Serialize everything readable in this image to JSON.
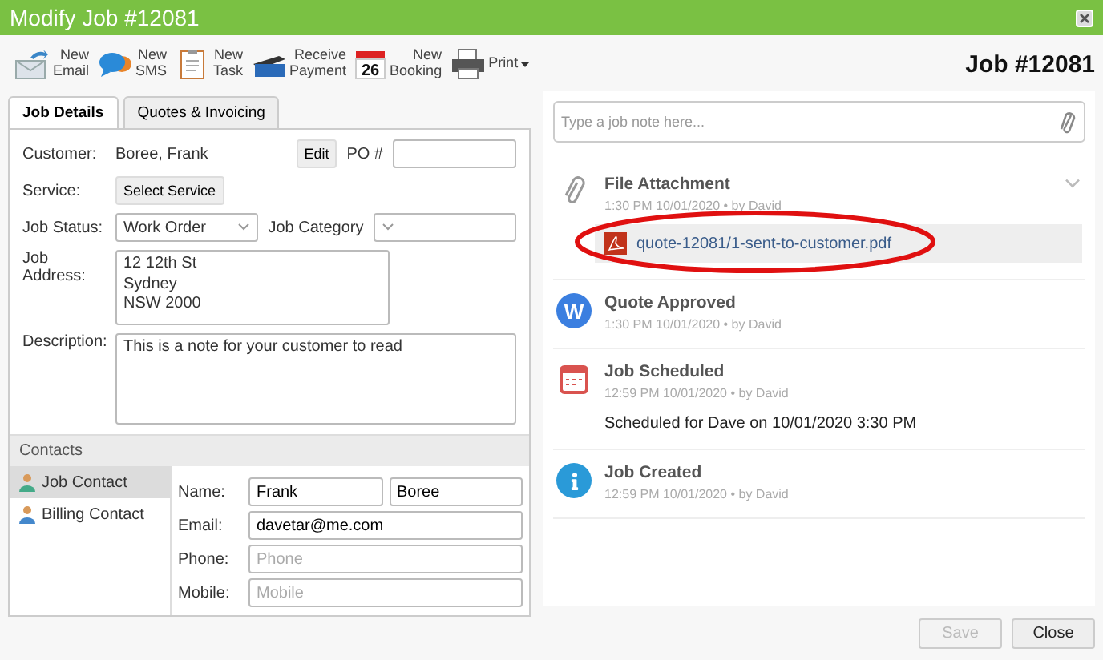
{
  "window": {
    "title": "Modify Job #12081"
  },
  "toolbar": [
    {
      "kind": "email",
      "label": "New Email"
    },
    {
      "kind": "sms",
      "label": "New SMS"
    },
    {
      "kind": "task",
      "label": "New Task"
    },
    {
      "kind": "payment",
      "label": "Receive Payment"
    },
    {
      "kind": "booking",
      "label": "New Booking",
      "badge": "26"
    },
    {
      "kind": "print",
      "label": "Print"
    }
  ],
  "tabs": [
    {
      "label": "Job Details",
      "selected": true
    },
    {
      "label": "Quotes & Invoicing",
      "selected": false
    }
  ],
  "form": {
    "customer_label": "Customer:",
    "customer": "Boree, Frank",
    "edit": "Edit",
    "po_label": "PO #",
    "service_label": "Service:",
    "service_button": "Select Service",
    "status_label": "Job Status:",
    "status": "Work Order",
    "category_label": "Job Category",
    "address_label": "Job Address:",
    "address": "12 12th St\nSydney\nNSW 2000",
    "description_label": "Description:",
    "description": "This is a note for your customer to read"
  },
  "contacts": {
    "title": "Contacts",
    "items": [
      {
        "label": "Job Contact",
        "selected": true
      },
      {
        "label": "Billing Contact",
        "selected": false
      }
    ],
    "fields": [
      {
        "label": "Name:",
        "values": [
          "Frank",
          "Boree"
        ]
      },
      {
        "label": "Email:",
        "value": "davetar@me.com"
      },
      {
        "label": "Phone:",
        "placeholder": "Phone"
      },
      {
        "label": "Mobile:",
        "placeholder": "Mobile"
      }
    ]
  },
  "job_heading": "Job #12081",
  "note": {
    "placeholder": "Type a job note here..."
  },
  "events": [
    {
      "kind": "attachment",
      "title": "File Attachment",
      "meta": "1:30 PM 10/01/2020 • by David",
      "file": "quote-12081/1-sent-to-customer.pdf",
      "expanded": false,
      "circled": true
    },
    {
      "kind": "quote",
      "title": "Quote Approved",
      "meta": "1:30 PM 10/01/2020 • by David",
      "letter": "W"
    },
    {
      "kind": "schedule",
      "title": "Job Scheduled",
      "meta": "12:59 PM 10/01/2020 • by David",
      "detail": "Scheduled for Dave on 10/01/2020 3:30 PM"
    },
    {
      "kind": "created",
      "title": "Job Created",
      "meta": "12:59 PM 10/01/2020 • by David"
    }
  ],
  "buttons": [
    {
      "label": "Save",
      "disabled": true
    },
    {
      "label": "Close",
      "disabled": false
    }
  ]
}
